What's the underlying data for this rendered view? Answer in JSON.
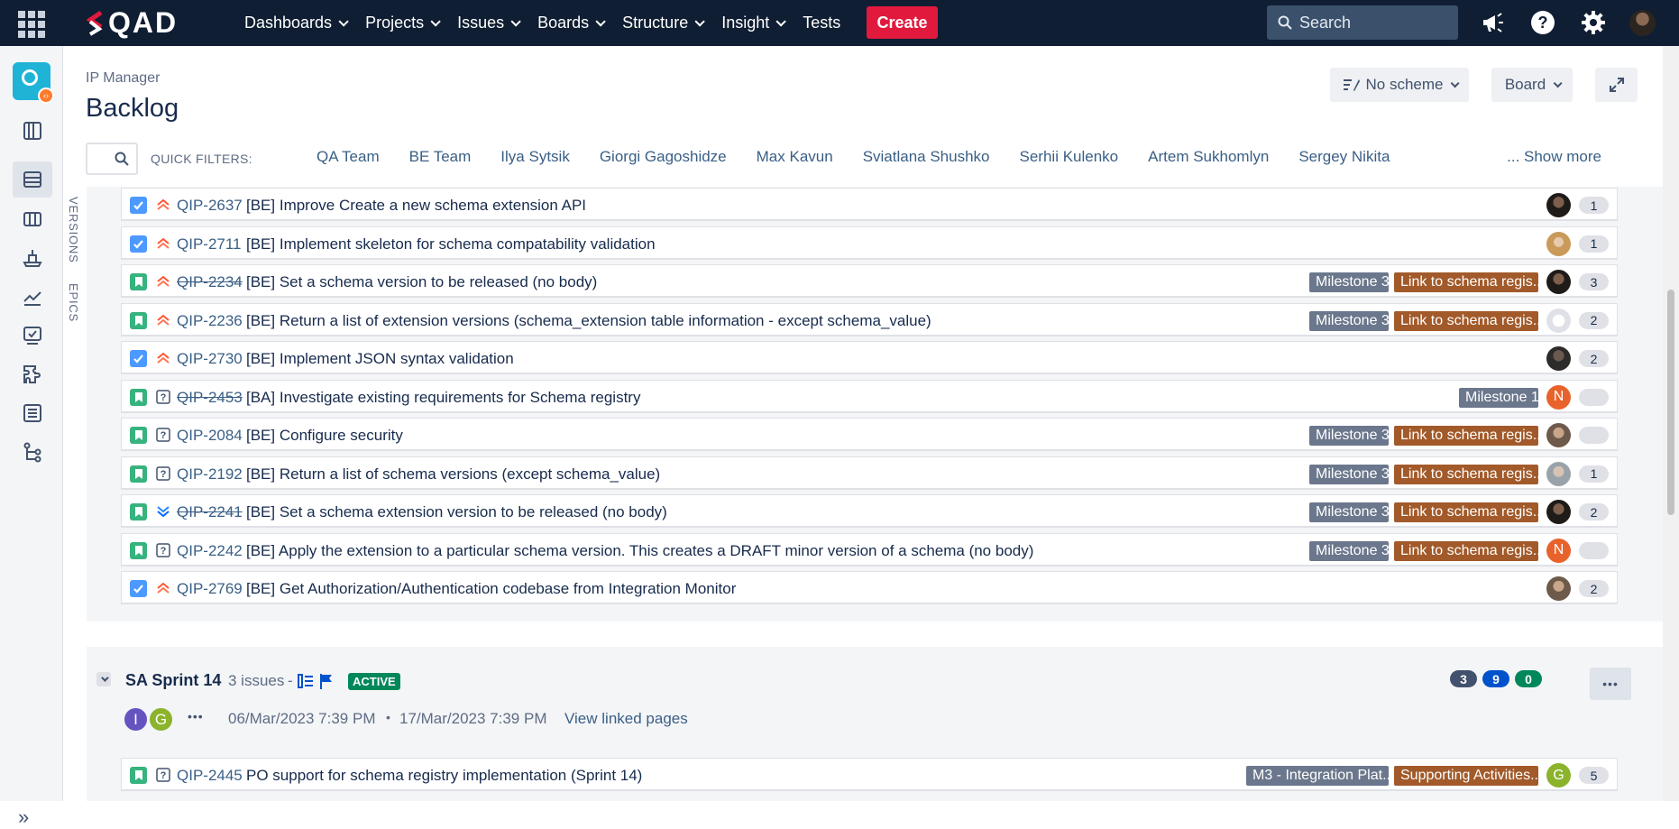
{
  "topnav": {
    "brand": "QAD",
    "items": [
      {
        "label": "Dashboards",
        "dropdown": true
      },
      {
        "label": "Projects",
        "dropdown": true
      },
      {
        "label": "Issues",
        "dropdown": true
      },
      {
        "label": "Boards",
        "dropdown": true
      },
      {
        "label": "Structure",
        "dropdown": true
      },
      {
        "label": "Insight",
        "dropdown": true
      },
      {
        "label": "Tests",
        "dropdown": false
      }
    ],
    "create_label": "Create",
    "search_placeholder": "Search",
    "icons": [
      "apps-grid-icon",
      "megaphone-icon",
      "help-icon",
      "settings-icon",
      "user-avatar"
    ]
  },
  "sidebar": {
    "icons": [
      "project-avatar",
      "roadmap-icon",
      "backlog-icon",
      "board-icon",
      "releases-icon",
      "reports-icon",
      "components-icon",
      "add-ons-icon",
      "issues-icon",
      "structure-icon"
    ],
    "expand_label": "»"
  },
  "header": {
    "breadcrumb": "IP Manager",
    "title": "Backlog",
    "scheme_label": "No scheme",
    "board_label": "Board",
    "quick_filters_label": "QUICK FILTERS:",
    "quick_filters": [
      "QA Team",
      "BE Team",
      "Ilya Sytsik",
      "Giorgi Gagoshidze",
      "Max Kavun",
      "Sviatlana Shushko",
      "Serhii Kulenko",
      "Artem Sukhomlyn",
      "Sergey Nikita"
    ],
    "show_more": "... Show more"
  },
  "side_tabs": {
    "versions": "VERSIONS",
    "epics": "EPICS"
  },
  "colors": {
    "nav_bg": "#0f1e33",
    "create": "#e0193d",
    "link": "#3a5f86",
    "version_lozenge": "#6b778c",
    "epic_lozenge": "#a25a2a",
    "active_lozenge": "#00875a"
  },
  "issues": [
    {
      "type": "task",
      "priority": "highest",
      "key": "QIP-2637",
      "done": false,
      "summary": "[BE] Improve Create a new schema extension API",
      "version": "",
      "epic": "",
      "avatar": "photo-dark",
      "estimate": "1"
    },
    {
      "type": "task",
      "priority": "highest",
      "key": "QIP-2711",
      "done": false,
      "summary": "[BE] Implement skeleton for schema compatability validation",
      "version": "",
      "epic": "",
      "avatar": "photo-blonde",
      "estimate": "1"
    },
    {
      "type": "story",
      "priority": "highest",
      "key": "QIP-2234",
      "done": true,
      "summary": "[BE] Set a schema version to be released (no body)",
      "version": "Milestone 3",
      "epic": "Link to schema regis...",
      "avatar": "photo-dark",
      "estimate": "3"
    },
    {
      "type": "story",
      "priority": "highest",
      "key": "QIP-2236",
      "done": false,
      "summary": "[BE] Return a list of extension versions (schema_extension table information - except schema_value)",
      "version": "Milestone 3",
      "epic": "Link to schema regis...",
      "avatar": "placeholder",
      "estimate": "2"
    },
    {
      "type": "task",
      "priority": "highest",
      "key": "QIP-2730",
      "done": false,
      "summary": "[BE] Implement JSON syntax validation",
      "version": "",
      "epic": "",
      "avatar": "photo-dark2",
      "estimate": "2"
    },
    {
      "type": "story",
      "priority": "unknown",
      "key": "QIP-2453",
      "done": true,
      "summary": "[BA] Investigate existing requirements for Schema registry",
      "version": "Milestone 1",
      "epic": "",
      "avatar": "N",
      "estimate": ""
    },
    {
      "type": "story",
      "priority": "unknown",
      "key": "QIP-2084",
      "done": false,
      "summary": "[BE] Configure security",
      "version": "Milestone 3",
      "epic": "Link to schema regis...",
      "avatar": "photo-light",
      "estimate": ""
    },
    {
      "type": "story",
      "priority": "unknown",
      "key": "QIP-2192",
      "done": false,
      "summary": "[BE] Return a list of schema versions (except schema_value)",
      "version": "Milestone 3",
      "epic": "Link to schema regis...",
      "avatar": "photo-grey",
      "estimate": "1"
    },
    {
      "type": "story",
      "priority": "lowest",
      "key": "QIP-2241",
      "done": true,
      "summary": "[BE] Set a schema extension version to be released (no body)",
      "version": "Milestone 3",
      "epic": "Link to schema regis...",
      "avatar": "photo-dark",
      "estimate": "2"
    },
    {
      "type": "story",
      "priority": "unknown",
      "key": "QIP-2242",
      "done": false,
      "summary": "[BE] Apply the extension to a particular schema version. This creates a DRAFT minor version of a schema (no body)",
      "version": "Milestone 3",
      "epic": "Link to schema regis...",
      "avatar": "N",
      "estimate": ""
    },
    {
      "type": "task",
      "priority": "highest",
      "key": "QIP-2769",
      "done": false,
      "summary": "[BE] Get Authorization/Authentication codebase from Integration Monitor",
      "version": "",
      "epic": "",
      "avatar": "photo-light",
      "estimate": "2"
    }
  ],
  "sprint": {
    "name": "SA Sprint 14",
    "issue_count": "3 issues",
    "separator": "-",
    "status": "ACTIVE",
    "counts": [
      {
        "value": "3",
        "color": "#42526e"
      },
      {
        "value": "9",
        "color": "#0052cc"
      },
      {
        "value": "0",
        "color": "#00875a"
      }
    ],
    "members": [
      {
        "initial": "I",
        "color": "#6554c0"
      },
      {
        "initial": "G",
        "color": "#8bb32b"
      }
    ],
    "more_members": "•••",
    "start": "06/Mar/2023 7:39 PM",
    "dot": "•",
    "end": "17/Mar/2023 7:39 PM",
    "linked_pages": "View linked pages",
    "more_button": "•••",
    "issues": [
      {
        "type": "story",
        "priority": "unknown",
        "key": "QIP-2445",
        "done": false,
        "summary": "PO support for schema registry implementation (Sprint 14)",
        "version": "M3 - Integration Plat...",
        "epic": "Supporting Activities...",
        "avatar": "G",
        "estimate": "5"
      }
    ]
  }
}
